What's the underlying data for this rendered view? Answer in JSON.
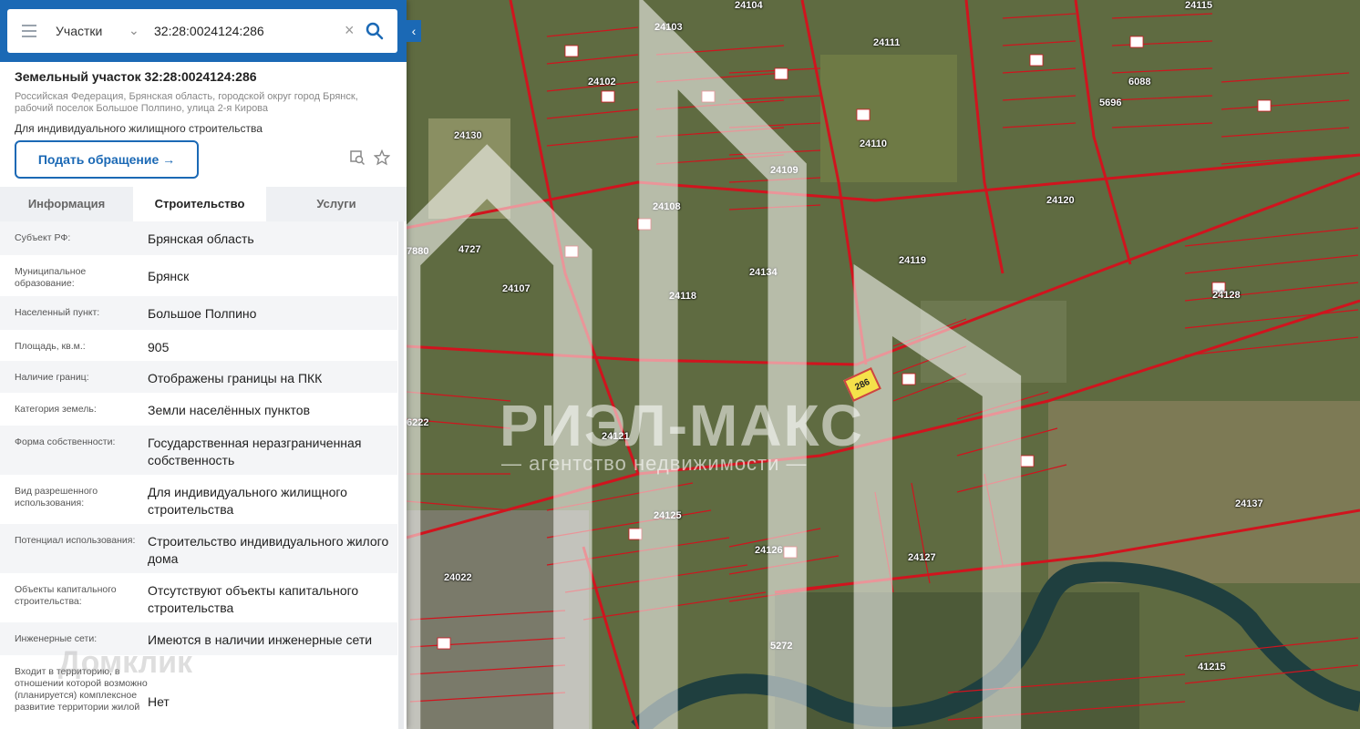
{
  "search": {
    "type_label": "Участки",
    "query": "32:28:0024124:286"
  },
  "plot": {
    "title": "Земельный участок 32:28:0024124:286",
    "address": "Российская Федерация, Брянская область, городской округ город Брянск, рабочий поселок Большое Полпино, улица 2-я Кирова",
    "purpose": "Для индивидуального жилищного строительства",
    "action_button": "Подать обращение →"
  },
  "tabs": [
    {
      "label": "Информация"
    },
    {
      "label": "Строительство"
    },
    {
      "label": "Услуги"
    }
  ],
  "info_rows": [
    {
      "key": "Субъект РФ:",
      "value": "Брянская область"
    },
    {
      "key": "Муниципальное образование:",
      "value": "Брянск"
    },
    {
      "key": "Населенный пункт:",
      "value": "Большое Полпино"
    },
    {
      "key": "Площадь, кв.м.:",
      "value": "905"
    },
    {
      "key": "Наличие границ:",
      "value": "Отображены границы на ПКК"
    },
    {
      "key": "Категория земель:",
      "value": "Земли населённых пунктов"
    },
    {
      "key": "Форма собственности:",
      "value": "Государственная неразграниченная собственность"
    },
    {
      "key": "Вид разрешенного использования:",
      "value": "Для индивидуального жилищного строительства"
    },
    {
      "key": "Потенциал использования:",
      "value": "Строительство индивидуального жилого дома"
    },
    {
      "key": "Объекты капитального строительства:",
      "value": "Отсутствуют объекты капитального строительства"
    },
    {
      "key": "Инженерные сети:",
      "value": "Имеются в наличии инженерные сети"
    },
    {
      "key": "Входит в территорию, в отношении которой возможно (планируется) комплексное развитие территории жилой",
      "value": "Нет"
    }
  ],
  "watermarks": {
    "brand": "РИЭЛ-МАКС",
    "brand_sub": "— агентство недвижимости —",
    "site": "Домклик"
  },
  "map_labels": [
    "24130",
    "24102",
    "24103",
    "24104",
    "24111",
    "24108",
    "24109",
    "24110",
    "24107",
    "24118",
    "24134",
    "24119",
    "24120",
    "24115",
    "24128",
    "24121",
    "24125",
    "24126",
    "24127",
    "24022",
    "24137",
    "41215",
    "5272",
    "4727",
    "7880",
    "6222",
    "5696",
    "6088"
  ],
  "plot_marker": "286",
  "colors": {
    "brand_blue": "#1b69b5",
    "boundary_red": "#d0141e",
    "highlight_yellow": "#f5e14a"
  }
}
